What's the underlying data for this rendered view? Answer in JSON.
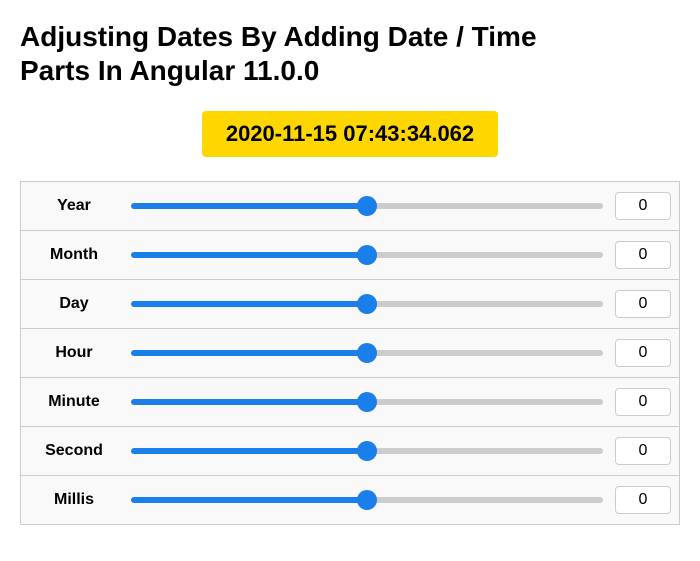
{
  "page": {
    "title_line1": "Adjusting Dates By Adding Date / Time",
    "title_line2": "Parts In Angular 11.0.0",
    "date_display": "2020-11-15 07:43:34.062"
  },
  "sliders": [
    {
      "id": "year",
      "label": "Year",
      "value": 0,
      "min": -100,
      "max": 100,
      "percent": 50
    },
    {
      "id": "month",
      "label": "Month",
      "value": 0,
      "min": -100,
      "max": 100,
      "percent": 50
    },
    {
      "id": "day",
      "label": "Day",
      "value": 0,
      "min": -100,
      "max": 100,
      "percent": 50
    },
    {
      "id": "hour",
      "label": "Hour",
      "value": 0,
      "min": -100,
      "max": 100,
      "percent": 50
    },
    {
      "id": "minute",
      "label": "Minute",
      "value": 0,
      "min": -100,
      "max": 100,
      "percent": 50
    },
    {
      "id": "second",
      "label": "Second",
      "value": 0,
      "min": -100,
      "max": 100,
      "percent": 50
    },
    {
      "id": "millis",
      "label": "Millis",
      "value": 0,
      "min": -100,
      "max": 100,
      "percent": 50
    }
  ]
}
